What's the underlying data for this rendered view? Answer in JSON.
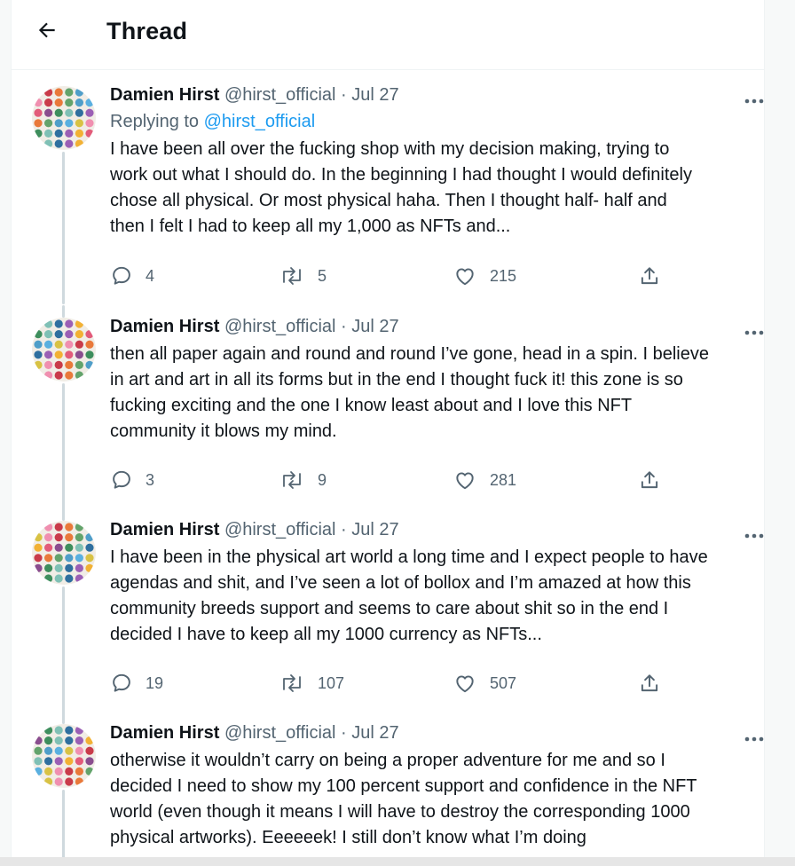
{
  "header": {
    "title": "Thread"
  },
  "tweets": [
    {
      "name": "Damien Hirst",
      "handle": "@hirst_official",
      "separator": "·",
      "date": "Jul 27",
      "replying_prefix": "Replying to ",
      "replying_handle": "@hirst_official",
      "text": "I have been all over the fucking shop with my decision making, trying to\nwork out what I should do. In the beginning I had thought I would definitely\nchose all physical. Or most physical haha. Then I thought half- half and\nthen I felt I had to keep all my 1,000 as NFTs and...",
      "replies": "4",
      "retweets": "5",
      "likes": "215"
    },
    {
      "name": "Damien Hirst",
      "handle": "@hirst_official",
      "separator": "·",
      "date": "Jul 27",
      "text": "then all paper again and round and round I’ve gone, head in a spin. I believe\nin art and art in all its forms but in the end I thought fuck it! this zone is so\nfucking exciting and the one I know least about and I love this NFT\ncommunity it blows my mind.",
      "replies": "3",
      "retweets": "9",
      "likes": "281"
    },
    {
      "name": "Damien Hirst",
      "handle": "@hirst_official",
      "separator": "·",
      "date": "Jul 27",
      "text": "I have been in the physical art world a long time and I expect people to have\nagendas and shit, and I’ve seen a lot of bollox and I’m amazed at how this\ncommunity breeds support and seems to care about shit so in the end I\ndecided I have to keep all my 1000 currency as NFTs...",
      "replies": "19",
      "retweets": "107",
      "likes": "507"
    },
    {
      "name": "Damien Hirst",
      "handle": "@hirst_official",
      "separator": "·",
      "date": "Jul 27",
      "text": "otherwise it wouldn’t carry on being a proper adventure for me and so I\ndecided I need to show my 100 percent support and confidence in the NFT\nworld (even though it means I will have to destroy the corresponding 1000\nphysical artworks). Eeeeeek! I still don’t know what I’m doing"
    }
  ],
  "icons": {
    "back": "arrow-left-icon",
    "more": "more-horizontal-icon",
    "reply": "reply-bubble-icon",
    "retweet": "retweet-icon",
    "like": "heart-icon",
    "share": "share-icon"
  },
  "colors": {
    "accent": "#1d9bf0",
    "secondary_text": "#536471",
    "thread_line": "#cfd9de"
  }
}
